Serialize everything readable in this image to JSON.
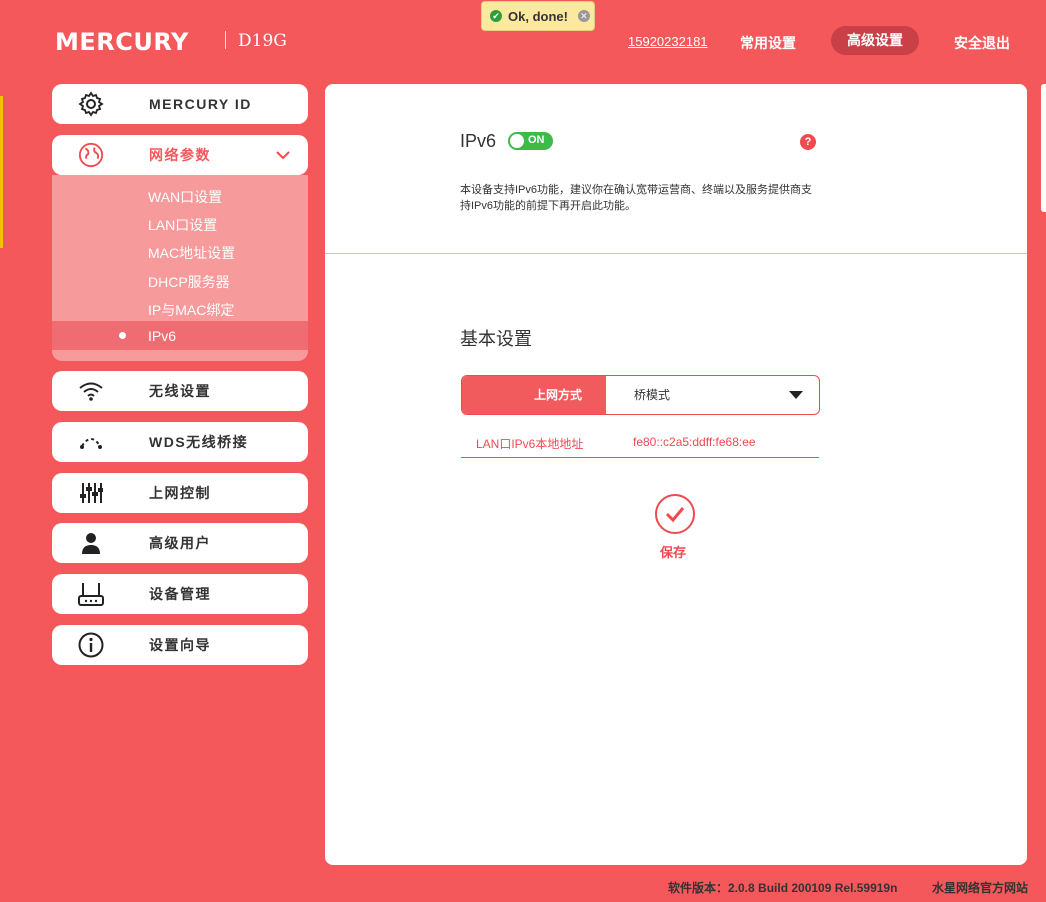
{
  "brand": {
    "logo": "MERCURY",
    "model": "D19G"
  },
  "toast": {
    "text": "Ok, done!"
  },
  "header": {
    "phone": "15920232181",
    "nav_common": "常用设置",
    "nav_advanced": "高级设置",
    "nav_logout": "安全退出"
  },
  "sidebar": {
    "items": [
      {
        "label": "MERCURY ID",
        "icon": "gear-icon"
      },
      {
        "label": "网络参数",
        "icon": "globe-icon"
      },
      {
        "label": "无线设置",
        "icon": "wifi-icon"
      },
      {
        "label": "WDS无线桥接",
        "icon": "bridge-icon"
      },
      {
        "label": "上网控制",
        "icon": "sliders-icon"
      },
      {
        "label": "高级用户",
        "icon": "user-icon"
      },
      {
        "label": "设备管理",
        "icon": "router-icon"
      },
      {
        "label": "设置向导",
        "icon": "info-icon"
      }
    ],
    "submenu": [
      "WAN口设置",
      "LAN口设置",
      "MAC地址设置",
      "DHCP服务器",
      "IP与MAC绑定",
      "IPv6"
    ]
  },
  "content": {
    "ipv6_title": "IPv6",
    "toggle_text": "ON",
    "help": "?",
    "description": "本设备支持IPv6功能，建议你在确认宽带运营商、终端以及服务提供商支持IPv6功能的前提下再开启此功能。",
    "section_title": "基本设置",
    "connection_label": "上网方式",
    "connection_value": "桥模式",
    "lan_ipv6_label": "LAN口IPv6本地地址",
    "lan_ipv6_value": "fe80::c2a5:ddff:fe68:ee",
    "save_label": "保存"
  },
  "footer": {
    "version": "软件版本：2.0.8 Build 200109 Rel.59919n",
    "link": "水星网络官方网站"
  },
  "colors": {
    "accent": "#f5585b",
    "toggle_on": "#3dbb4a",
    "toast_bg": "#fbe9a0"
  }
}
